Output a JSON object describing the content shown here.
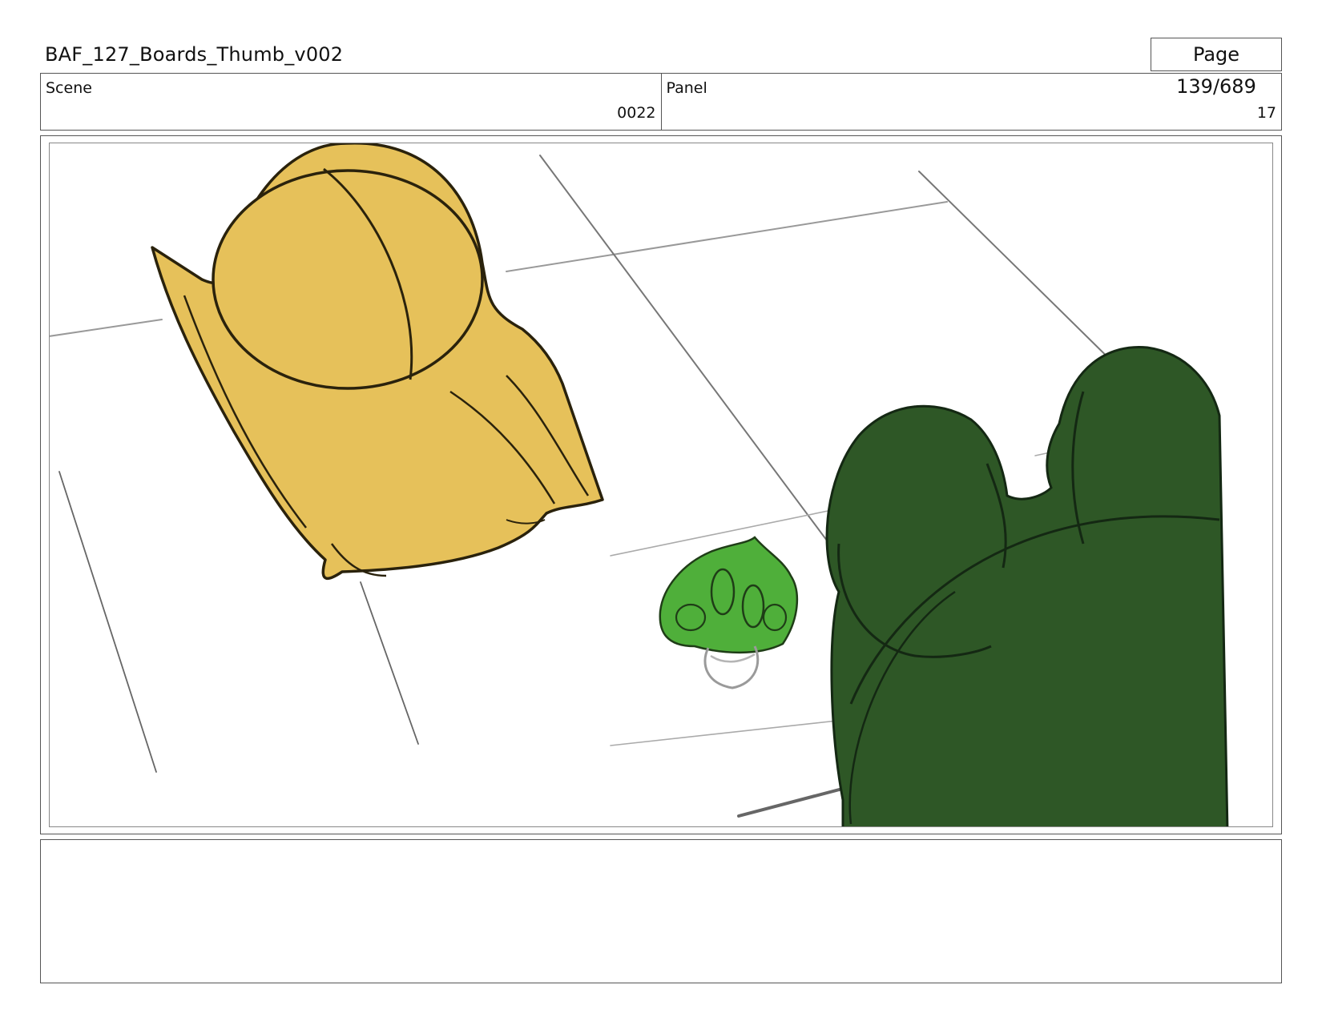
{
  "header": {
    "document_title": "BAF_127_Boards_Thumb_v002",
    "page_label": "Page 139/689"
  },
  "info": {
    "scene_label": "Scene",
    "scene_value": "0022",
    "panel_label": "Panel",
    "panel_value": "17"
  },
  "panel_art": {
    "colors": {
      "yellow_character": "#E6C15A",
      "small_green_character": "#4FAF3A",
      "dark_green_character": "#2E5726",
      "sketch_line": "#1A1A1A",
      "floor_line": "#8A8A8A"
    }
  },
  "notes": {
    "text": ""
  }
}
